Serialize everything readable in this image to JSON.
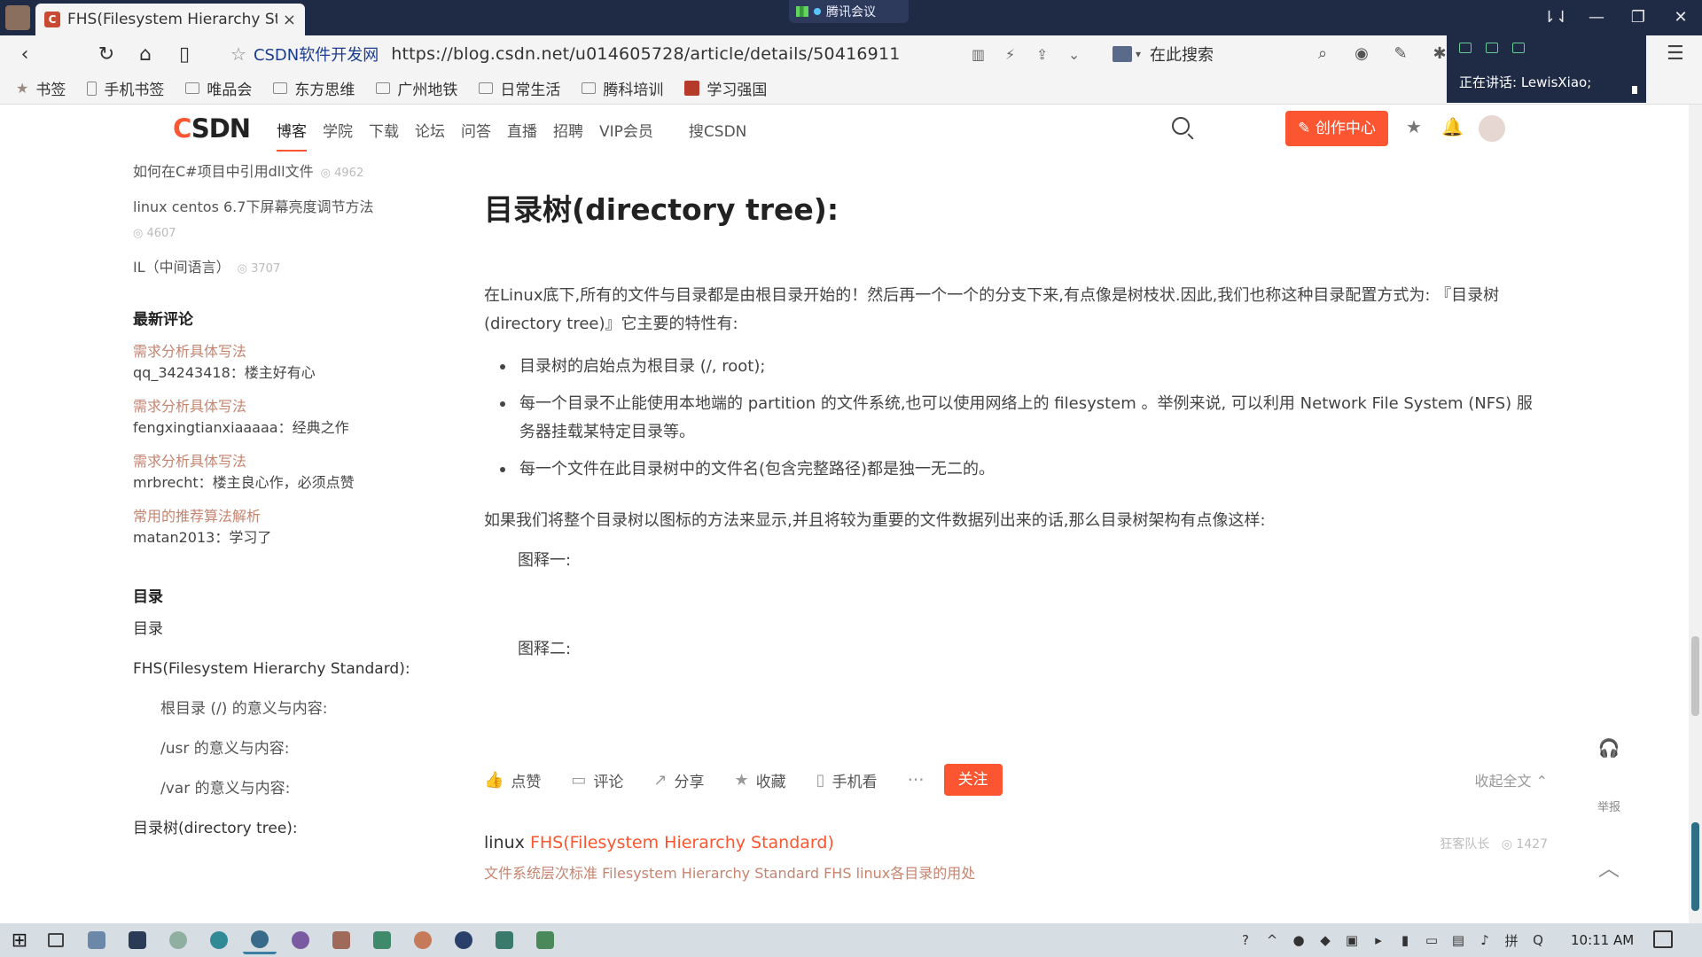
{
  "window": {
    "tab_title": "FHS(Filesystem Hierarchy St:",
    "tab_close": "×",
    "meeting_label": "腾讯会议",
    "controls": {
      "pin": "⇂⇃",
      "minimize": "—",
      "restore": "❐",
      "close": "✕"
    }
  },
  "addressbar": {
    "site_name": "CSDN软件开发网",
    "url": "https://blog.csdn.net/u014605728/article/details/50416911",
    "search_label": "在此搜索"
  },
  "speaking": {
    "label": "正在讲话: LewisXiao;"
  },
  "bookmarks": [
    {
      "label": "书签",
      "icon": "star-icon"
    },
    {
      "label": "手机书签",
      "icon": "phone-icon"
    },
    {
      "label": "唯品会",
      "icon": "folder-icon"
    },
    {
      "label": "东方思维",
      "icon": "folder-icon"
    },
    {
      "label": "广州地铁",
      "icon": "folder-icon"
    },
    {
      "label": "日常生活",
      "icon": "folder-icon"
    },
    {
      "label": "腾科培训",
      "icon": "folder-icon"
    },
    {
      "label": "学习强国",
      "icon": "xuexi-icon"
    }
  ],
  "csdn": {
    "logo_c": "C",
    "logo_rest": "SDN",
    "nav": [
      "博客",
      "学院",
      "下载",
      "论坛",
      "问答",
      "直播",
      "招聘",
      "VIP会员"
    ],
    "search_csdn": "搜CSDN",
    "create_label": "创作中心"
  },
  "sidebar": {
    "popular": [
      {
        "title": "如何在C#项目中引用dll文件",
        "views": "4962"
      },
      {
        "title": "linux centos 6.7下屏幕亮度调节方法",
        "views": "4607"
      },
      {
        "title": "IL（中间语言）",
        "views": "3707"
      }
    ],
    "comments_heading": "最新评论",
    "comments": [
      {
        "title": "需求分析具体写法",
        "body": "qq_34243418：楼主好有心"
      },
      {
        "title": "需求分析具体写法",
        "body": "fengxingtianxiaaaaa：经典之作"
      },
      {
        "title": "需求分析具体写法",
        "body": "mrbrecht：楼主良心作，必须点赞"
      },
      {
        "title": "常用的推荐算法解析",
        "body": "matan2013：学习了"
      }
    ],
    "toc_heading": "目录",
    "toc": [
      {
        "label": "目录",
        "sub": false
      },
      {
        "label": "FHS(Filesystem Hierarchy Standard):",
        "sub": false
      },
      {
        "label": "根目录 (/) 的意义与内容:",
        "sub": true
      },
      {
        "label": "/usr 的意义与内容:",
        "sub": true
      },
      {
        "label": "/var 的意义与内容:",
        "sub": true
      },
      {
        "label": "目录树(directory tree):",
        "sub": false
      }
    ]
  },
  "article": {
    "heading": "目录树(directory tree):",
    "intro": "在Linux底下,所有的文件与目录都是由根目录开始的！然后再一个一个的分支下来,有点像是树枝状.因此,我们也称这种目录配置方式为: 『目录树(directory tree)』它主要的特性有:",
    "bullets": [
      "目录树的启始点为根目录 (/, root);",
      "每一个目录不止能使用本地端的 partition 的文件系统,也可以使用网络上的 filesystem 。举例来说, 可以利用 Network File System (NFS) 服务器挂载某特定目录等。",
      "每一个文件在此目录树中的文件名(包含完整路径)都是独一无二的。"
    ],
    "summary": "如果我们将整个目录树以图标的方法来显示,并且将较为重要的文件数据列出来的话,那么目录树架构有点像这样:",
    "caption1": "图释一:",
    "caption2": "图释二:"
  },
  "actions": {
    "like": "点赞",
    "comment": "评论",
    "share": "分享",
    "favorite": "收藏",
    "mobile": "手机看",
    "more": "···",
    "follow": "关注",
    "collapse": "收起全文 ⌃"
  },
  "related": {
    "prefix": "linux ",
    "highlight": "FHS",
    "rest": "(Filesystem Hierarchy Standard)",
    "desc": "文件系统层次标准 Filesystem Hierarchy Standard FHS linux各目录的用处",
    "author": "狂客队长",
    "views": "1427"
  },
  "right_tools": {
    "report": "举报"
  },
  "taskbar": {
    "clock": "10:11 AM"
  },
  "colors": {
    "brand": "#fc5531",
    "titlebar": "#1f2a44",
    "link": "#c58470"
  }
}
